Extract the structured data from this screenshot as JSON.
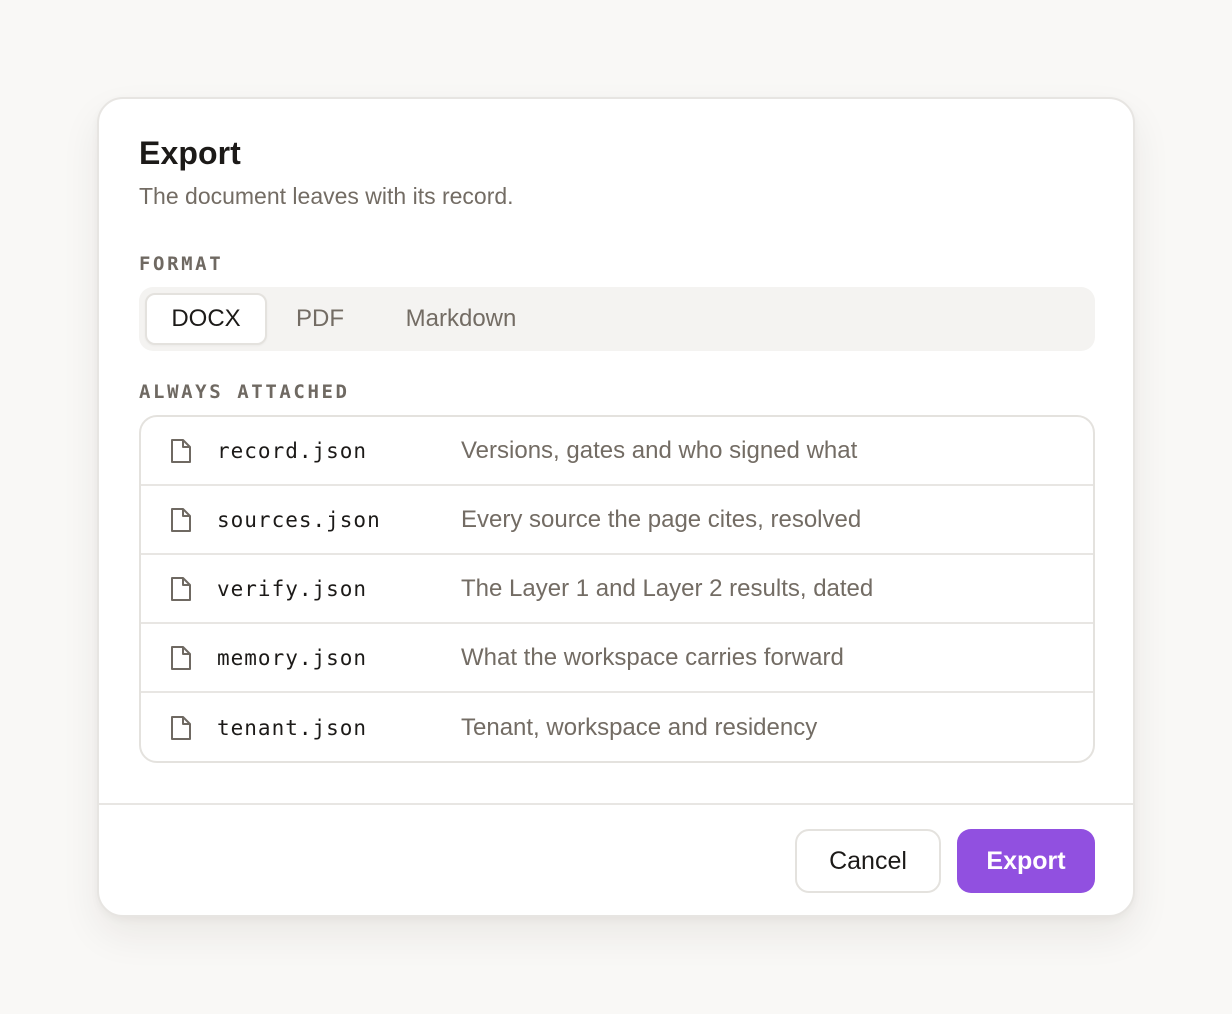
{
  "dialog": {
    "title": "Export",
    "subtitle": "The document leaves with its record."
  },
  "format": {
    "label": "FORMAT",
    "options": [
      "DOCX",
      "PDF",
      "Markdown"
    ],
    "selected": "DOCX"
  },
  "attached": {
    "label": "ALWAYS ATTACHED",
    "icon": "file-icon",
    "files": [
      {
        "name": "record.json",
        "desc": "Versions, gates and who signed what"
      },
      {
        "name": "sources.json",
        "desc": "Every source the page cites, resolved"
      },
      {
        "name": "verify.json",
        "desc": "The Layer 1 and Layer 2 results, dated"
      },
      {
        "name": "memory.json",
        "desc": "What the workspace carries forward"
      },
      {
        "name": "tenant.json",
        "desc": "Tenant, workspace and residency"
      }
    ]
  },
  "actions": {
    "cancel_label": "Cancel",
    "export_label": "Export"
  },
  "colors": {
    "accent": "#9150e0",
    "text": "#1c1a18",
    "muted": "#736c64",
    "border": "#e4e2de",
    "background": "#f9f8f6"
  }
}
